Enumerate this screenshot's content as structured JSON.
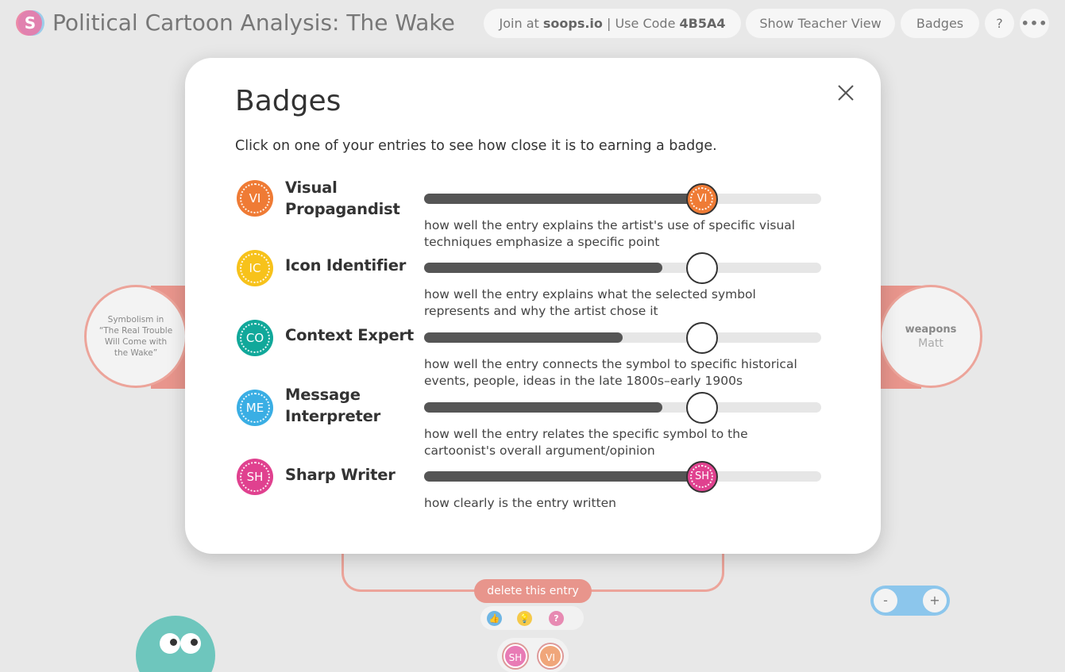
{
  "header": {
    "title": "Political Cartoon Analysis: The Wake",
    "join_prefix": "Join at ",
    "join_site": "soops.io",
    "join_mid": " | Use Code ",
    "join_code": "4B5A4",
    "teacher_view": "Show Teacher View",
    "badges": "Badges",
    "help": "?",
    "more": "•••"
  },
  "canvas": {
    "left_node": "Symbolism in “The Real Trouble Will Come with the Wake”",
    "right_node_title": "weapons",
    "right_node_author": "Matt",
    "delete_entry": "delete this entry",
    "mini_badges": [
      "SH",
      "VI"
    ],
    "zoom_out": "-",
    "zoom_in": "+"
  },
  "modal": {
    "title": "Badges",
    "subtitle": "Click on one of your entries to see how close it is to earning a badge.",
    "badges": [
      {
        "abbr": "VI",
        "name_line1": "Visual",
        "name_line2": "Propagandist",
        "desc": "how well the entry explains the artist's use of specific visual techniques emphasize a specific point",
        "progress": 0.7,
        "earned": true,
        "color": "#ef7b35"
      },
      {
        "abbr": "IC",
        "name_line1": "Icon Identifier",
        "name_line2": "",
        "desc": "how well the entry explains what the selected symbol represents and why the artist chose it",
        "progress": 0.6,
        "earned": false,
        "color": "#f7c21b"
      },
      {
        "abbr": "CO",
        "name_line1": "Context Expert",
        "name_line2": "",
        "desc": "how well the entry connects the symbol to specific historical events, people, ideas in the late 1800s–early 1900s",
        "progress": 0.5,
        "earned": false,
        "color": "#11a89a"
      },
      {
        "abbr": "ME",
        "name_line1": "Message",
        "name_line2": "Interpreter",
        "desc": "how well the entry relates the specific symbol to the cartoonist's overall argument/opinion",
        "progress": 0.6,
        "earned": false,
        "color": "#3aaee4"
      },
      {
        "abbr": "SH",
        "name_line1": "Sharp Writer",
        "name_line2": "",
        "desc": "how clearly is the entry written",
        "progress": 0.7,
        "earned": true,
        "color": "#e0418f"
      }
    ]
  }
}
